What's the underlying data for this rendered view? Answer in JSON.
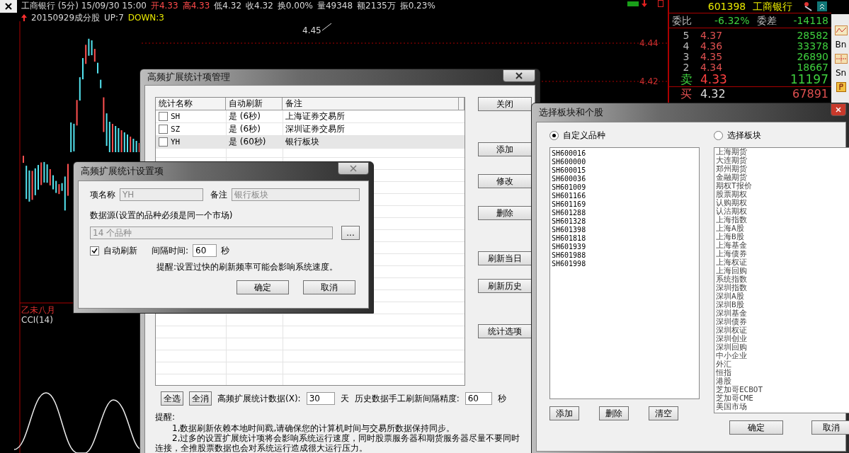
{
  "chart": {
    "quote_line": [
      {
        "text": "工商银行 (5分) 15/09/30 15:00",
        "rising": false
      },
      {
        "text": "开4.33",
        "rising": true
      },
      {
        "text": "高4.33",
        "rising": true
      },
      {
        "text": "低4.32",
        "rising": false
      },
      {
        "text": "收4.32",
        "rising": false
      },
      {
        "text": "换0.00%",
        "rising": false
      },
      {
        "text": "量49348",
        "rising": false
      },
      {
        "text": "额2135万",
        "rising": false
      },
      {
        "text": "振0.23%",
        "rising": false
      }
    ],
    "indicator": {
      "label": "20150929成分股",
      "up": "UP:7",
      "down": "DOWN:3"
    },
    "price_tag": "4.45",
    "axis_labels": [
      "4.44",
      "4.42"
    ],
    "lunar_label": "乙未八月",
    "sub_indicator": "CCI(14)"
  },
  "quote_panel": {
    "code": "601398",
    "name": "工商银行",
    "ratio_label": "委比",
    "ratio": "-6.32%",
    "diff_label": "委差",
    "diff": "-14118",
    "asks": [
      {
        "rank": "5",
        "price": "4.37",
        "volume": "28582"
      },
      {
        "rank": "4",
        "price": "4.36",
        "volume": "33378"
      },
      {
        "rank": "3",
        "price": "4.35",
        "volume": "26890"
      },
      {
        "rank": "2",
        "price": "4.34",
        "volume": "18667"
      }
    ],
    "sell": {
      "label": "卖",
      "price": "4.33",
      "volume": "11197"
    },
    "buy": {
      "label": "买",
      "price": "4.32",
      "volume": "67891"
    }
  },
  "side_toolbar": {
    "labels": [
      "Bn",
      "Sn"
    ]
  },
  "manager": {
    "title": "高频扩展统计项管理",
    "columns": [
      "统计名称",
      "自动刷新",
      "备注"
    ],
    "rows": [
      {
        "checked": false,
        "name": "SH",
        "auto": "是 (6秒)",
        "note": "上海证券交易所",
        "selected": false
      },
      {
        "checked": false,
        "name": "SZ",
        "auto": "是 (6秒)",
        "note": "深圳证券交易所",
        "selected": false
      },
      {
        "checked": false,
        "name": "YH",
        "auto": "是 (60秒)",
        "note": "银行板块",
        "selected": true
      }
    ],
    "button_groups": [
      [
        "关闭"
      ],
      [
        "添加",
        "修改",
        "删除"
      ],
      [
        "刷新当日",
        "刷新历史"
      ],
      [
        "统计选项"
      ]
    ],
    "select_all": "全选",
    "clear_all": "全消",
    "days_label": "高频扩展统计数据(X):",
    "days_value": "30",
    "days_unit": "天",
    "interval_label": "历史数据手工刷新间隔精度:",
    "interval_value": "60",
    "interval_unit": "秒",
    "tips_title": "提醒:",
    "tips": [
      "1,数据刷新依赖本地时间戳,请确保您的计算机时间与交易所数据保持同步。",
      "2,过多的设置扩展统计项将会影响系统运行速度，同时股票服务器和期货服务器尽量不要同时连接，全推股票数据也会对系统运行造成很大运行压力。"
    ]
  },
  "settings": {
    "title": "高频扩展统计设置项",
    "name_label": "项名称",
    "name_value": "YH",
    "note_label": "备注",
    "note_value": "银行板块",
    "source_label": "数据源(设置的品种必须是同一个市场)",
    "source_value": "14 个品种",
    "browse": "...",
    "auto_refresh": {
      "label": "自动刷新",
      "checked": true
    },
    "interval_label": "间隔时间:",
    "interval_value": "60",
    "interval_unit": "秒",
    "hint": "提醒:设置过快的刷新频率可能会影响系统速度。",
    "ok": "确定",
    "cancel": "取消"
  },
  "picker": {
    "title": "选择板块和个股",
    "options": [
      {
        "label": "自定义品种",
        "selected": true
      },
      {
        "label": "选择板块",
        "selected": false
      }
    ],
    "codes": [
      "SH600016",
      "SH600000",
      "SH600015",
      "SH600036",
      "SH601009",
      "SH601166",
      "SH601169",
      "SH601288",
      "SH601328",
      "SH601398",
      "SH601818",
      "SH601939",
      "SH601988",
      "SH601998"
    ],
    "boards": [
      "上海期货",
      "大连期货",
      "郑州期货",
      "金融期货",
      "期权T报价",
      "股票期权",
      "认购期权",
      "认沽期权",
      "上海指数",
      "上海A股",
      "上海B股",
      "上海基金",
      "上海债券",
      "上海权证",
      "上海回购",
      "系统指数",
      "深圳指数",
      "深圳A股",
      "深圳B股",
      "深圳基金",
      "深圳债券",
      "深圳权证",
      "深圳创业",
      "深圳回购",
      "中小企业",
      "外汇",
      "恒指",
      "港股",
      "芝加哥ECBOT",
      "芝加哥CME",
      "美国市场"
    ],
    "list_buttons": [
      "添加",
      "删除",
      "清空"
    ],
    "ok": "确定",
    "cancel": "取消"
  }
}
